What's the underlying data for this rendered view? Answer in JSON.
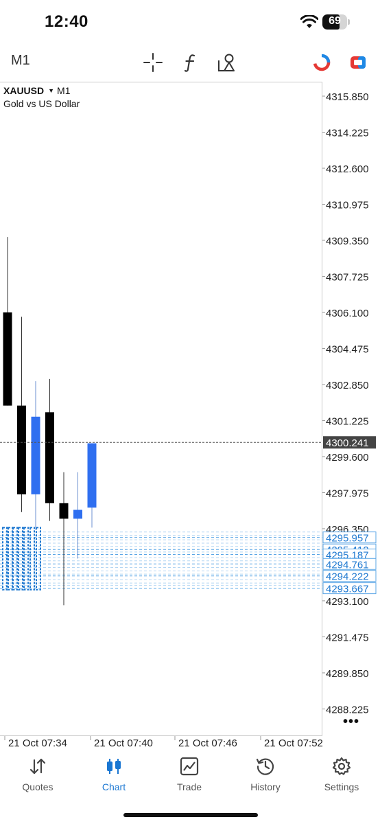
{
  "status_bar": {
    "time": "12:40",
    "battery_level": "69",
    "battery_fraction": 0.69
  },
  "toolbar": {
    "timeframe": "M1",
    "icons": [
      "crosshair-icon",
      "indicators-icon",
      "objects-icon",
      "one-click-trading-icon",
      "trade-button-icon"
    ]
  },
  "chart": {
    "symbol": "XAUUSD",
    "symbol_timeframe": "M1",
    "description": "Gold vs US Dollar",
    "current_price_label": "4300.241",
    "colors": {
      "bull": "#2f6ff0",
      "bear": "#000000",
      "level": "#5aa6e6",
      "price_line": "#555555"
    }
  },
  "chart_data": {
    "type": "candlestick",
    "y_ticks": [
      "4315.850",
      "4314.225",
      "4312.600",
      "4310.975",
      "4309.350",
      "4307.725",
      "4306.100",
      "4304.475",
      "4302.850",
      "4301.225",
      "4299.600",
      "4297.975",
      "4296.350",
      "4293.100",
      "4291.475",
      "4289.850",
      "4288.225"
    ],
    "ylim": [
      4287.0,
      4316.5
    ],
    "x_ticks": [
      "21 Oct 07:34",
      "21 Oct 07:40",
      "21 Oct 07:46",
      "21 Oct 07:52"
    ],
    "candles": [
      {
        "open": 4306.1,
        "high": 4309.5,
        "low": 4301.9,
        "close": 4301.9
      },
      {
        "open": 4301.9,
        "high": 4305.9,
        "low": 4297.1,
        "close": 4297.9
      },
      {
        "open": 4297.9,
        "high": 4303.0,
        "low": 4296.3,
        "close": 4301.4
      },
      {
        "open": 4301.6,
        "high": 4303.1,
        "low": 4296.7,
        "close": 4297.5
      },
      {
        "open": 4297.5,
        "high": 4298.9,
        "low": 4292.9,
        "close": 4296.8
      },
      {
        "open": 4296.8,
        "high": 4298.9,
        "low": 4295.0,
        "close": 4297.2
      },
      {
        "open": 4297.3,
        "high": 4300.2,
        "low": 4296.4,
        "close": 4300.2
      }
    ],
    "current_price": 4300.241,
    "level_labels": [
      "4295.957",
      "4295.412",
      "4295.187",
      "4294.761",
      "4294.222",
      "4293.667"
    ],
    "level_values": [
      4295.957,
      4295.412,
      4295.187,
      4294.761,
      4294.222,
      4293.667
    ],
    "faint_levels": [
      4296.2,
      4296.05,
      4295.85,
      4295.7,
      4295.55,
      4295.3,
      4295.05,
      4294.9,
      4294.6,
      4294.45,
      4294.3,
      4294.05,
      4293.9,
      4293.8
    ]
  },
  "tabs": [
    {
      "label": "Quotes",
      "icon": "quotes-icon"
    },
    {
      "label": "Chart",
      "icon": "chart-icon",
      "active": true
    },
    {
      "label": "Trade",
      "icon": "trade-icon"
    },
    {
      "label": "History",
      "icon": "history-icon"
    },
    {
      "label": "Settings",
      "icon": "settings-icon"
    }
  ]
}
